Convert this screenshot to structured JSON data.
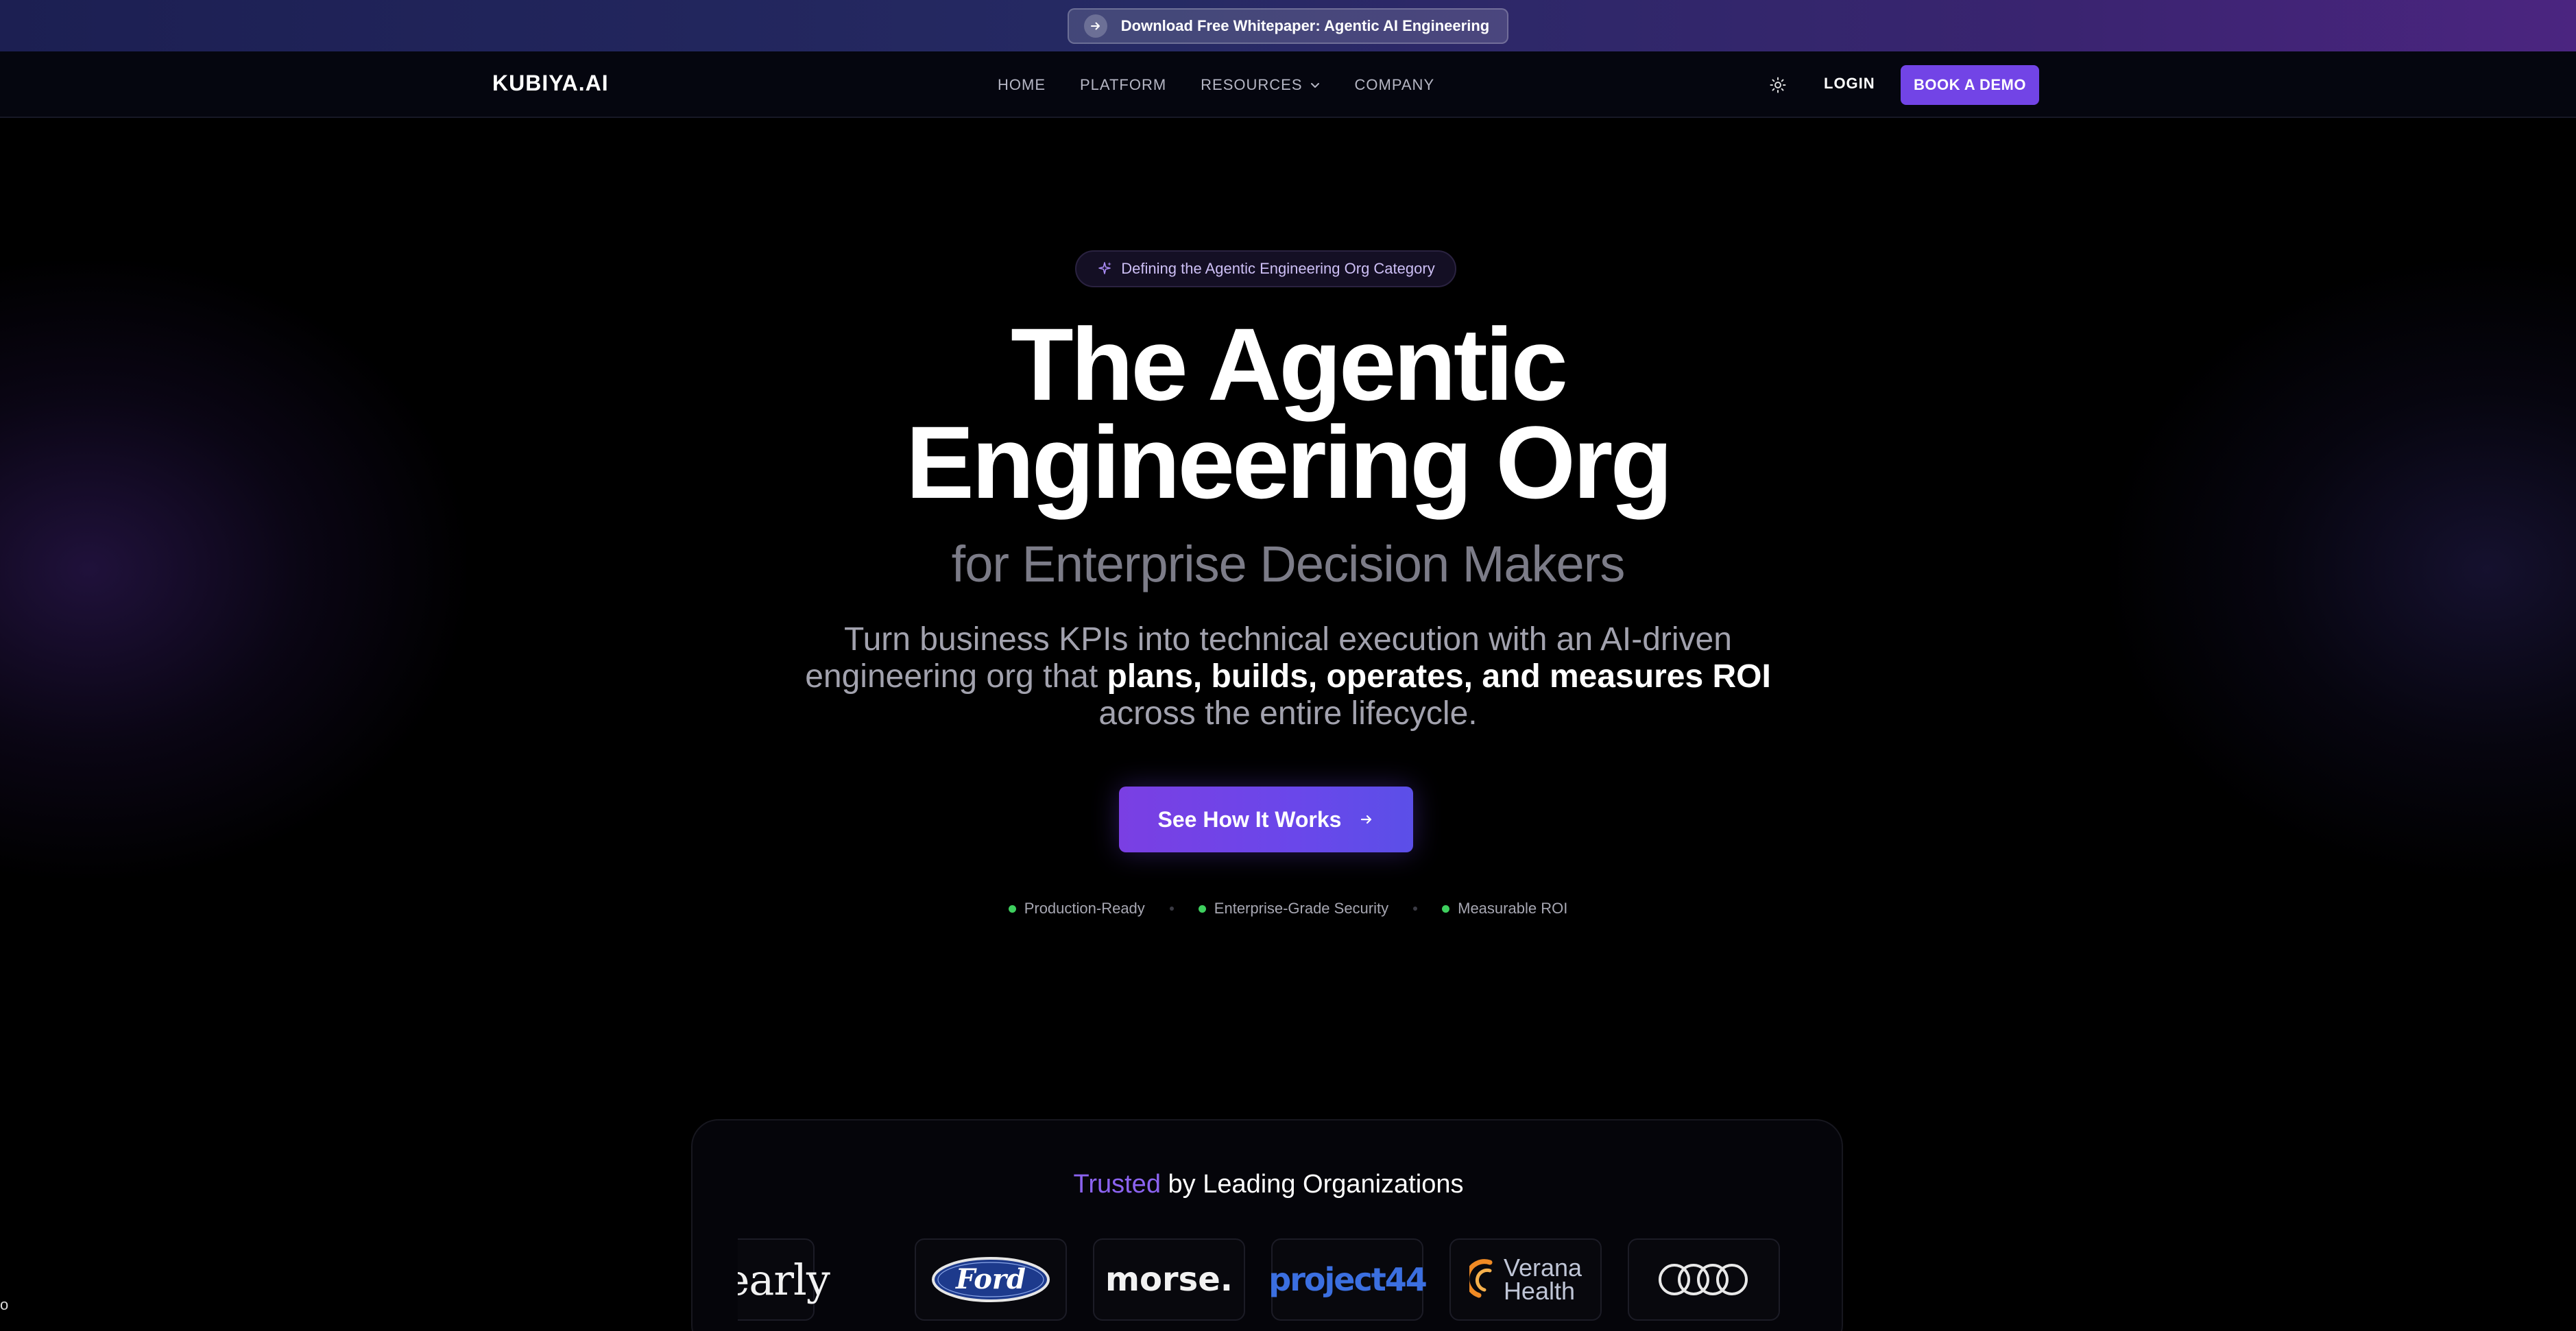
{
  "banner": {
    "text": "Download Free Whitepaper: Agentic AI Engineering",
    "icon": "arrow-right-icon"
  },
  "nav": {
    "logo": "KUBIYA.AI",
    "links": [
      {
        "label": "HOME"
      },
      {
        "label": "PLATFORM"
      },
      {
        "label": "RESOURCES",
        "has_dropdown": true
      },
      {
        "label": "COMPANY"
      }
    ],
    "theme_toggle_icon": "sun-icon",
    "login": "LOGIN",
    "book_demo": "BOOK A DEMO"
  },
  "hero": {
    "badge": "Defining the Agentic Engineering Org Category",
    "badge_icon": "sparkle-icon",
    "title_line1": "The Agentic",
    "title_line2": "Engineering Org",
    "subtitle": "for Enterprise Decision Makers",
    "description_pre": "Turn business KPIs into technical execution with an AI-driven engineering org that ",
    "description_bold": "plans, builds, operates, and measures ROI",
    "description_post": " across the entire lifecycle.",
    "cta": "See How It Works",
    "features": [
      "Production-Ready",
      "Enterprise-Grade Security",
      "Measurable ROI"
    ]
  },
  "trusted": {
    "title_accent": "Trusted",
    "title_rest": " by Leading Organizations",
    "logos": [
      {
        "name": "clearly",
        "text": "clearly"
      },
      {
        "name": "ford",
        "text": "Ford"
      },
      {
        "name": "morse",
        "text": "morse."
      },
      {
        "name": "project44",
        "text": "project44"
      },
      {
        "name": "verana-health",
        "text_line1": "Verana",
        "text_line2": "Health"
      },
      {
        "name": "audi",
        "text": ""
      }
    ]
  },
  "colors": {
    "accent": "#7244e6",
    "accent_text": "#8b63f0",
    "status_green": "#3ecf5e",
    "background": "#000000"
  },
  "corner_text": "o"
}
